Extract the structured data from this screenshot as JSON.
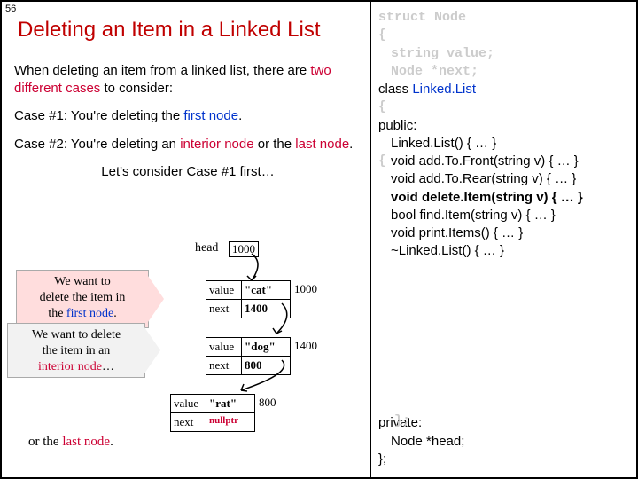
{
  "slide_number": "56",
  "title": "Deleting an Item in a Linked List",
  "intro": {
    "pre": "When deleting an item from a linked list, there are ",
    "two_diff": "two different cases",
    "post": " to consider:"
  },
  "case1": {
    "pre": "Case #1: You're deleting the ",
    "em": "first node",
    "post": "."
  },
  "case2": {
    "pre": "Case #2: You're deleting an ",
    "em1": "interior node",
    "mid": " or the ",
    "em2": "last node",
    "post": "."
  },
  "lets": "Let's consider Case #1 first…",
  "head_label": "head",
  "head_addr": "1000",
  "nodes": [
    {
      "addr": "1000",
      "value": "\"cat\"",
      "next": "1400"
    },
    {
      "addr": "1400",
      "value": "\"dog\"",
      "next": "800"
    },
    {
      "addr": "800",
      "value": "\"rat\"",
      "next": "nullptr"
    }
  ],
  "callout_first": {
    "l1": "We want to",
    "l2": "delete the item in",
    "l3_pre": "the ",
    "l3_em": "first node",
    "l3_post": "."
  },
  "callout_interior": {
    "l1": "We want to delete",
    "l2": "the item in an",
    "l3_em": "interior node",
    "l3_post": "…"
  },
  "or_last": {
    "pre": "or the ",
    "em": "last node",
    "post": "."
  },
  "code": {
    "struct1": "struct Node",
    "struct2": "{",
    "struct3": "string value;",
    "struct4": "Node *next;",
    "struct5": "};",
    "class_pre": "class ",
    "class_name": "Linked.List",
    "brace": "{",
    "public": "public:",
    "ghost_brace": "{",
    "ctor": "Linked.List() { … }",
    "addfront": "void add.To.Front(string v) { … }",
    "addrear": "void add.To.Rear(string v) { … }",
    "delete": "void delete.Item(string v) { … }",
    "find": "bool find.Item(string v) { … }",
    "print": "void print.Items() { … }",
    "dtor": "~Linked.List() { … }",
    "ghost_end": "};",
    "private": "private:",
    "headmem": "Node *head;",
    "end": "};"
  }
}
